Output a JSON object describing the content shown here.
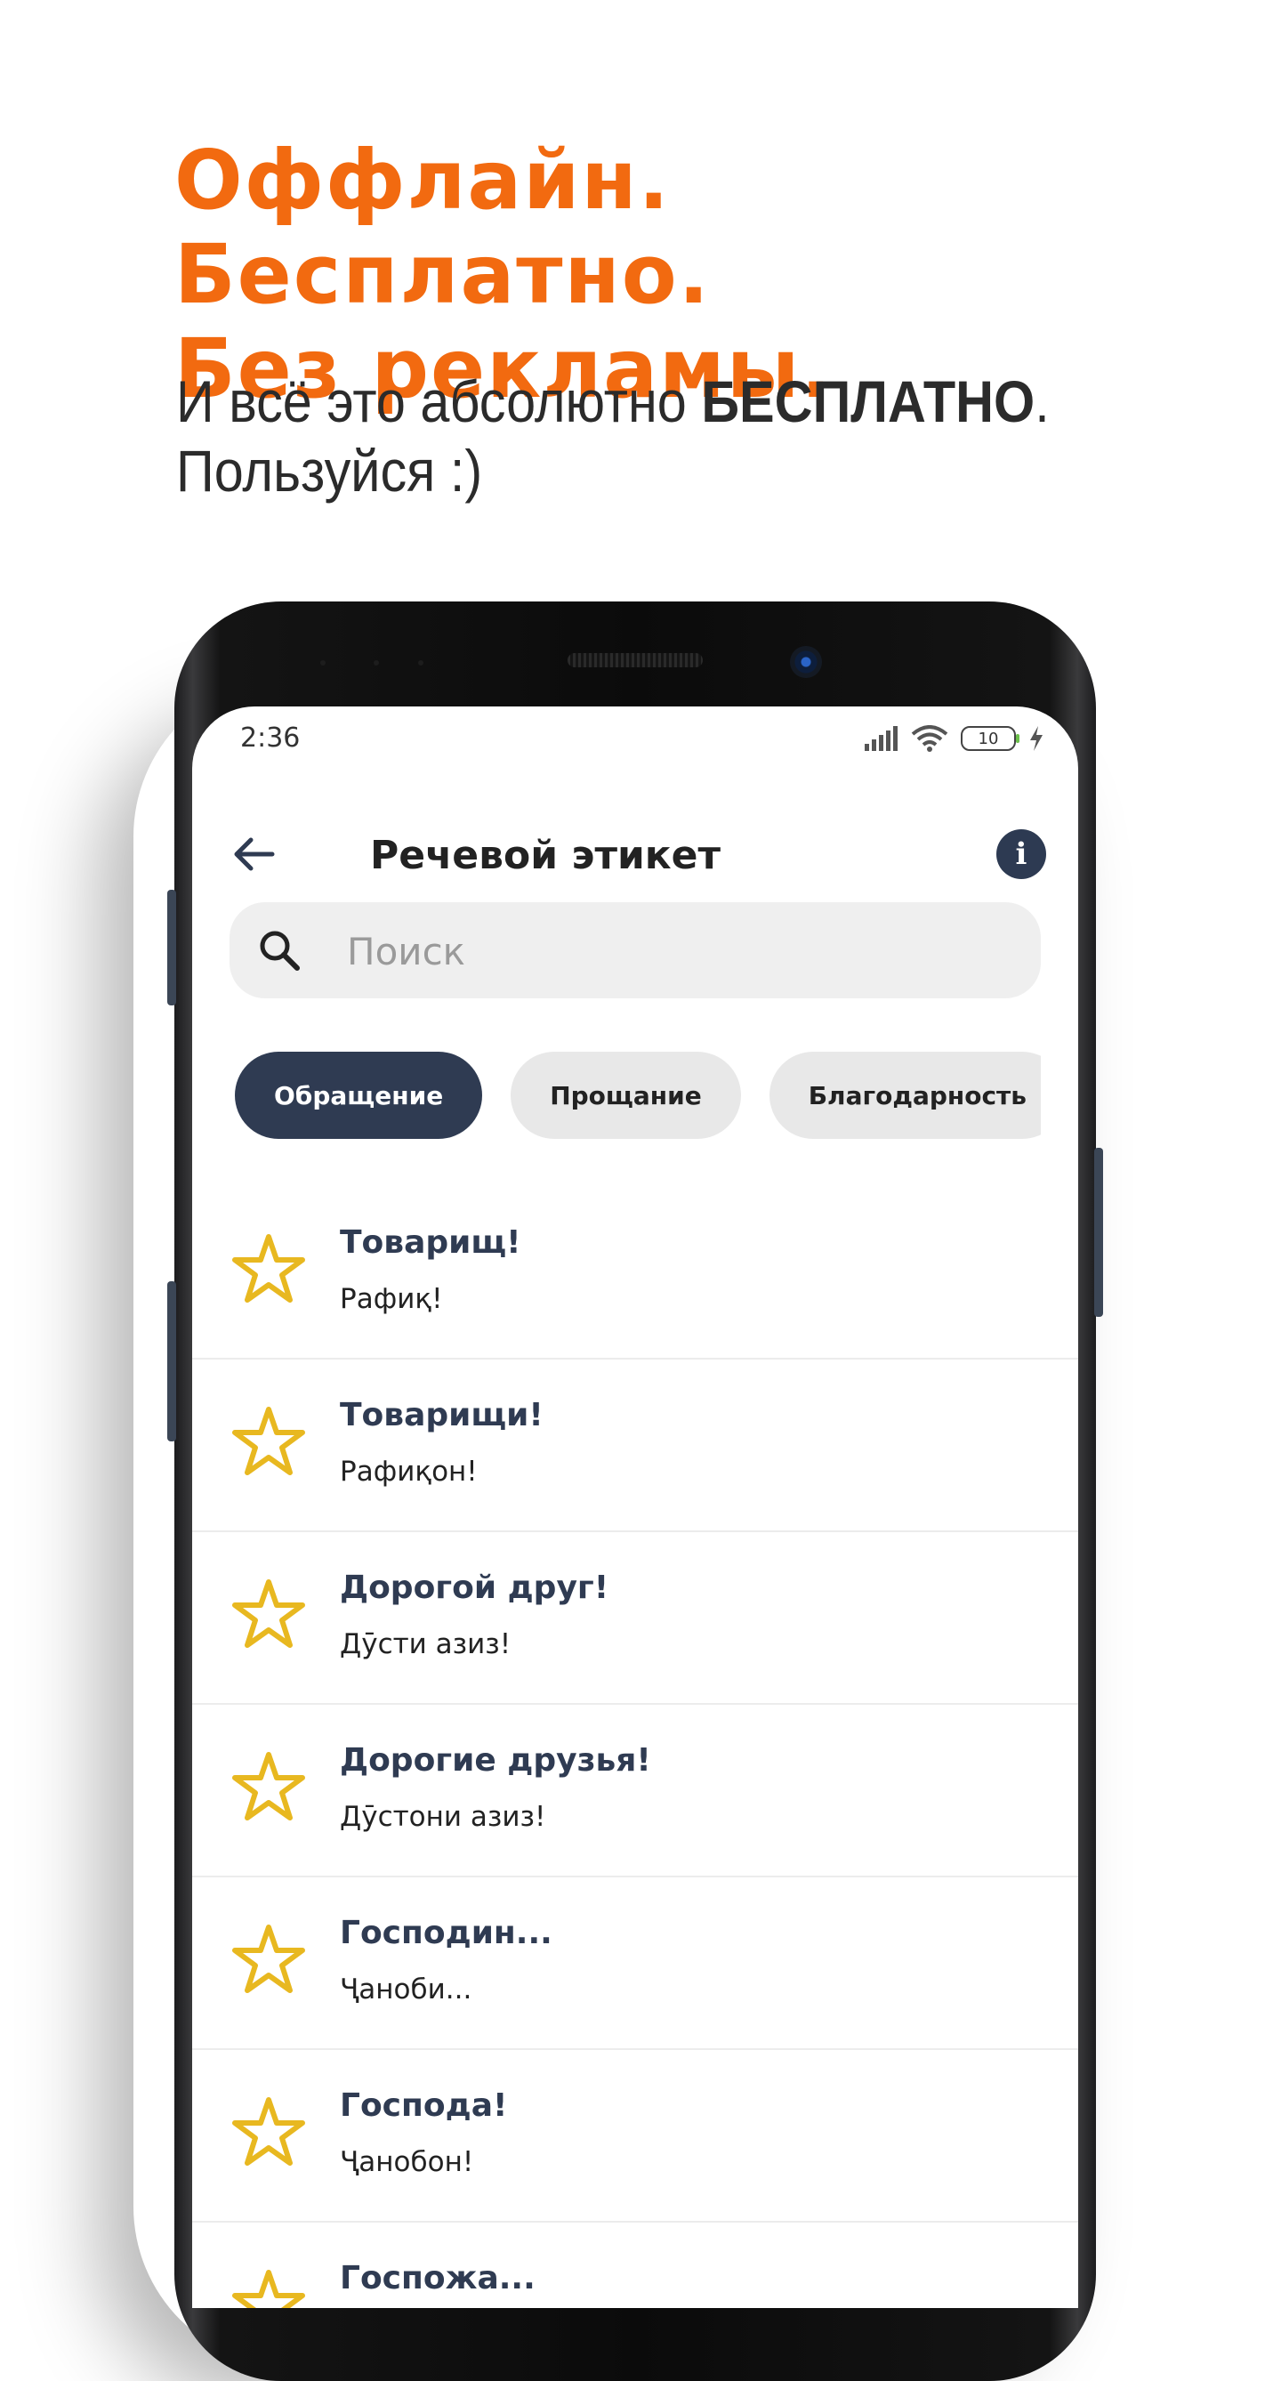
{
  "promo": {
    "title_line1": "Оффлайн. Бесплатно.",
    "title_line2": "Без рекламы.",
    "sub_line1_prefix": "И всё это абсолютно ",
    "sub_line1_bold": "БЕСПЛАТНО",
    "sub_line1_suffix": ".",
    "sub_line2": "Пользуйся :)"
  },
  "status_bar": {
    "time": "2:36",
    "battery": "10"
  },
  "appbar": {
    "title": "Речевой этикет",
    "back_icon": "arrow-left-icon",
    "info_icon": "info-icon"
  },
  "search": {
    "placeholder": "Поиск",
    "value": ""
  },
  "chips": [
    {
      "label": "Обращение",
      "active": true
    },
    {
      "label": "Прощание",
      "active": false
    },
    {
      "label": "Благодарность",
      "active": false
    },
    {
      "label": "",
      "active": false
    }
  ],
  "items": [
    {
      "title": "Товарищ!",
      "subtitle": "Рафиқ!"
    },
    {
      "title": "Товарищи!",
      "subtitle": "Рафиқон!"
    },
    {
      "title": "Дорогой друг!",
      "subtitle": "Дӯсти азиз!"
    },
    {
      "title": "Дорогие друзья!",
      "subtitle": "Дӯстони азиз!"
    },
    {
      "title": "Господин...",
      "subtitle": "Ҷаноби..."
    },
    {
      "title": "Господа!",
      "subtitle": "Ҷанобон!"
    },
    {
      "title": "Госпожа...",
      "subtitle": ""
    }
  ],
  "colors": {
    "accent_orange": "#f26a10",
    "primary_navy": "#2f3b52",
    "star_gold": "#e8b820"
  }
}
